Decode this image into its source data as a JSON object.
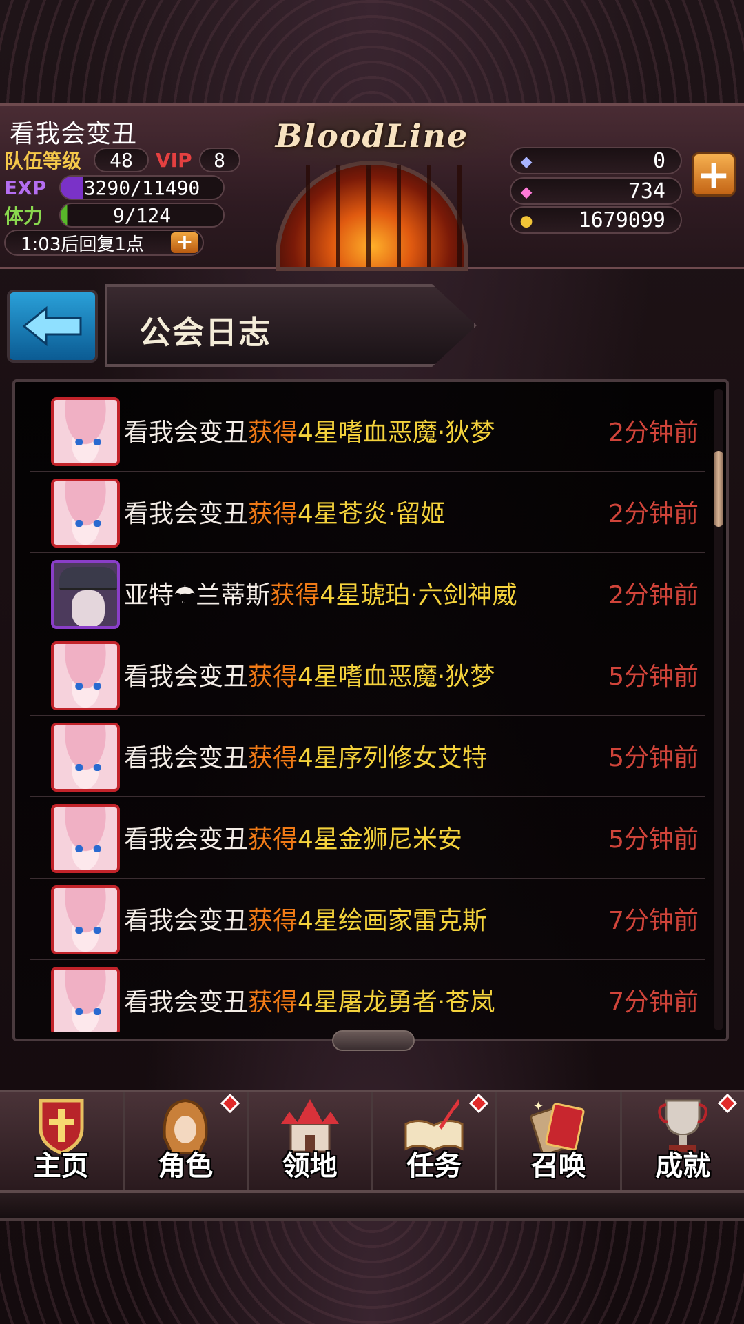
{
  "player": {
    "name": "看我会变丑",
    "team_level_label": "队伍等级",
    "team_level": "48",
    "vip_label": "VIP",
    "vip_level": "8",
    "exp_label": "EXP",
    "exp_value": "3290/11490",
    "stamina_label": "体力",
    "stamina_value": "9/124",
    "regen_text": "1:03后回复1点"
  },
  "logo": "BloodLine",
  "currency": {
    "crystal": "0",
    "gem": "734",
    "gold": "1679099"
  },
  "page": {
    "title": "公会日志"
  },
  "log": [
    {
      "name": "看我会变丑",
      "action": "获得",
      "item": "4星嗜血恶魔·狄梦",
      "time": "2分钟前",
      "avatar": "pink"
    },
    {
      "name": "看我会变丑",
      "action": "获得",
      "item": "4星苍炎·留姬",
      "time": "2分钟前",
      "avatar": "pink"
    },
    {
      "name": "亚特☂兰蒂斯",
      "action": "获得",
      "item": "4星琥珀·六剑神威",
      "time": "2分钟前",
      "avatar": "purple"
    },
    {
      "name": "看我会变丑",
      "action": "获得",
      "item": "4星嗜血恶魔·狄梦",
      "time": "5分钟前",
      "avatar": "pink"
    },
    {
      "name": "看我会变丑",
      "action": "获得",
      "item": "4星序列修女艾特",
      "time": "5分钟前",
      "avatar": "pink"
    },
    {
      "name": "看我会变丑",
      "action": "获得",
      "item": "4星金狮尼米安",
      "time": "5分钟前",
      "avatar": "pink"
    },
    {
      "name": "看我会变丑",
      "action": "获得",
      "item": "4星绘画家雷克斯",
      "time": "7分钟前",
      "avatar": "pink"
    },
    {
      "name": "看我会变丑",
      "action": "获得",
      "item": "4星屠龙勇者·苍岚",
      "time": "7分钟前",
      "avatar": "pink"
    }
  ],
  "nav": [
    {
      "label": "主页",
      "icon": "shield-cross-icon",
      "badge": false
    },
    {
      "label": "角色",
      "icon": "hooded-figure-icon",
      "badge": true
    },
    {
      "label": "领地",
      "icon": "castle-icon",
      "badge": false
    },
    {
      "label": "任务",
      "icon": "book-quill-icon",
      "badge": true
    },
    {
      "label": "召唤",
      "icon": "cards-icon",
      "badge": false
    },
    {
      "label": "成就",
      "icon": "trophy-icon",
      "badge": true
    }
  ]
}
